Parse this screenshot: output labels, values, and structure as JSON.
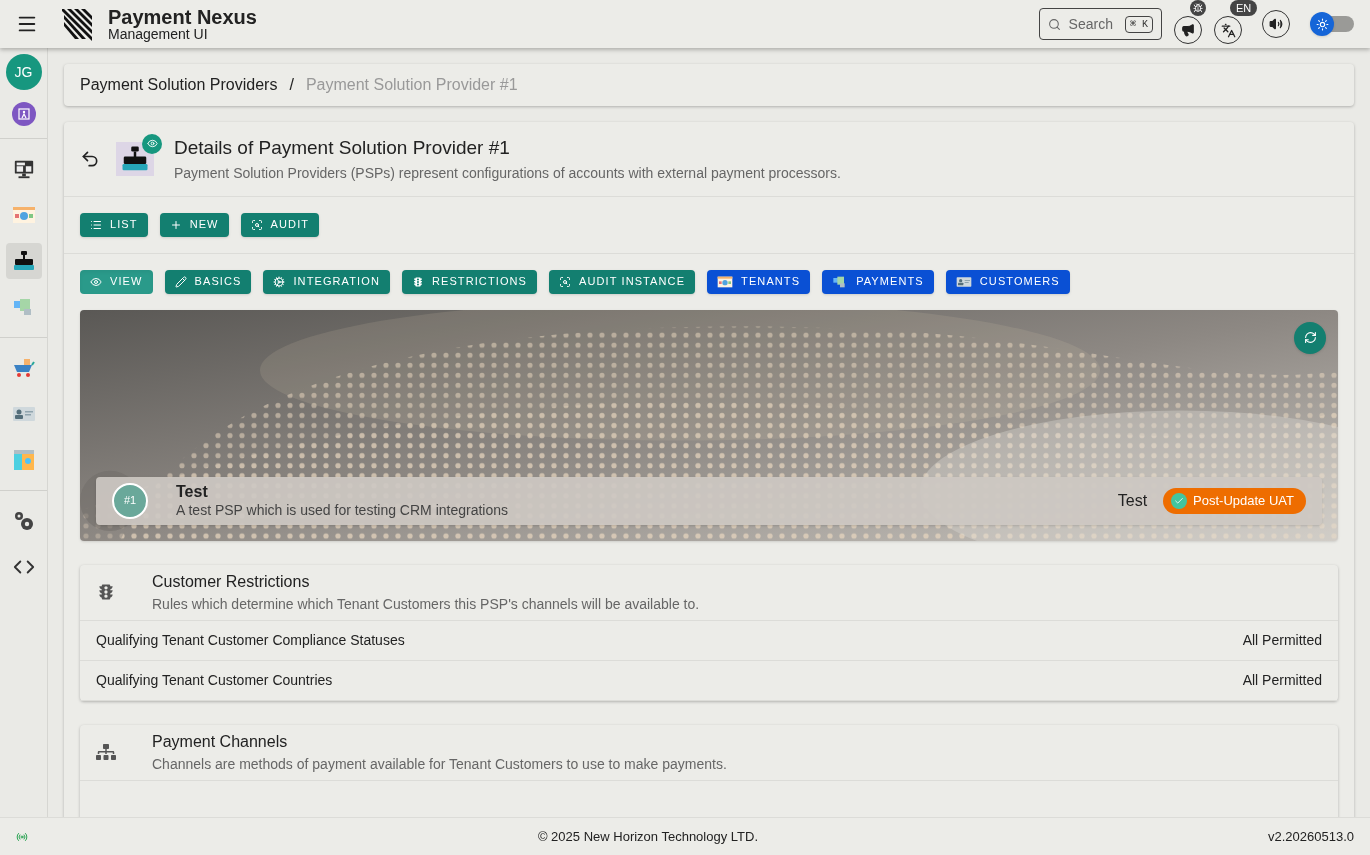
{
  "header": {
    "app_name": "Payment Nexus",
    "app_subtitle": "Management UI",
    "search": {
      "placeholder": "Search",
      "shortcut": "⌘ K"
    },
    "language_badge": "EN",
    "theme_toggle": {
      "on": false
    }
  },
  "sidebar": {
    "avatar": "JG",
    "groups": [
      {
        "items": [
          {
            "kind": "monitor",
            "selected": false
          },
          {
            "kind": "tenants",
            "selected": false
          },
          {
            "kind": "register",
            "selected": true
          },
          {
            "kind": "payments",
            "selected": false
          }
        ]
      },
      {
        "items": [
          {
            "kind": "cart",
            "selected": false
          },
          {
            "kind": "idcard",
            "selected": false
          },
          {
            "kind": "ledger",
            "selected": false
          }
        ]
      },
      {
        "items": [
          {
            "kind": "settings",
            "selected": false
          },
          {
            "kind": "code",
            "selected": false
          }
        ]
      }
    ]
  },
  "breadcrumb": [
    "Payment Solution Providers",
    "/",
    "Payment Solution Provider #1"
  ],
  "page": {
    "title": "Details of Payment Solution Provider #1",
    "subtitle": "Payment Solution Providers (PSPs) represent configurations of accounts with external payment processors."
  },
  "actions": [
    {
      "label": "LIST"
    },
    {
      "label": "NEW"
    },
    {
      "label": "AUDIT"
    }
  ],
  "tabs": [
    {
      "label": "VIEW",
      "kind": "action",
      "selected": true
    },
    {
      "label": "BASICS",
      "kind": "action",
      "selected": false
    },
    {
      "label": "INTEGRATION",
      "kind": "action",
      "selected": false
    },
    {
      "label": "RESTRICTIONS",
      "kind": "action",
      "selected": false
    },
    {
      "label": "AUDIT INSTANCE",
      "kind": "action",
      "selected": false
    },
    {
      "label": "TENANTS",
      "kind": "link",
      "selected": false
    },
    {
      "label": "PAYMENTS",
      "kind": "link",
      "selected": false
    },
    {
      "label": "CUSTOMERS",
      "kind": "link",
      "selected": false
    }
  ],
  "summary": {
    "number": "#1",
    "name": "Test",
    "description": "A test PSP which is used for testing CRM integrations",
    "tenant": "Test",
    "environment": "Post-Update UAT"
  },
  "sections": [
    {
      "title": "Customer Restrictions",
      "subtitle": "Rules which determine which Tenant Customers this PSP's channels will be available to.",
      "rows": [
        {
          "label": "Qualifying Tenant Customer Compliance Statuses",
          "value": "All Permitted"
        },
        {
          "label": "Qualifying Tenant Customer Countries",
          "value": "All Permitted"
        }
      ]
    },
    {
      "title": "Payment Channels",
      "subtitle": "Channels are methods of payment available for Tenant Customers to use to make payments."
    }
  ],
  "footer": {
    "copyright": "© 2025 New Horizon Technology LTD.",
    "version": "v2.20260513.0"
  }
}
